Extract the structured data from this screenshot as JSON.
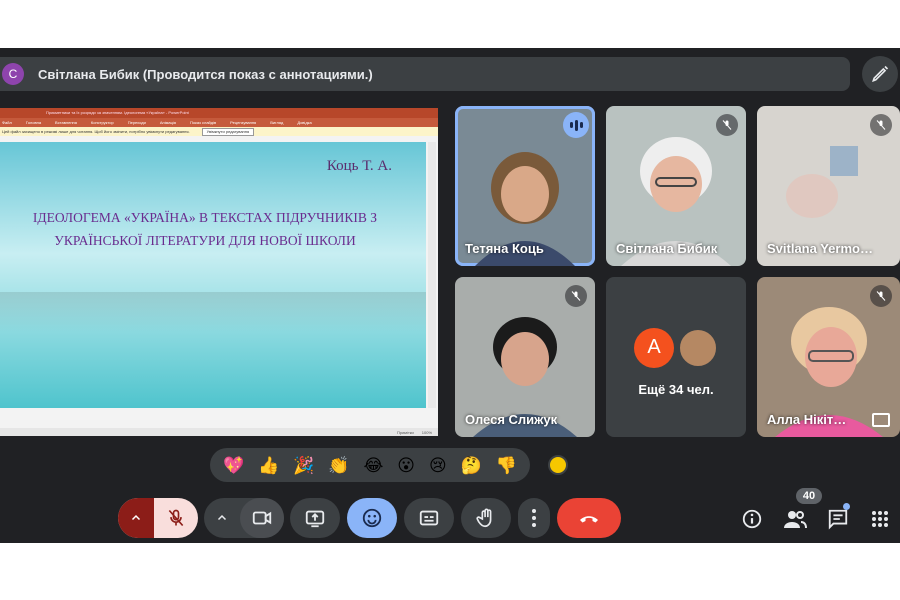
{
  "banner": {
    "avatar_letter": "С",
    "text": "Світлана Бибик (Проводится показ с аннотациями.)"
  },
  "presentation": {
    "window_title": "Прикметники та їх розряди за значенням. Ідеологема «Україна» - PowerPoint",
    "ribbon": [
      "Файл",
      "Головна",
      "Вставлення",
      "Конструктор",
      "Переходи",
      "Анімація",
      "Показ слайдів",
      "Рецензування",
      "Вигляд",
      "Довідка"
    ],
    "warning_text": "Цей файл захищено в режимі лише для читання. Щоб його змінити, потрібно увімкнути редагування.",
    "warning_button": "Увімкнути редагування",
    "author": "Коць Т. А.",
    "heading_line1": "ІДЕОЛОГЕМА «УКРАЇНА» В ТЕКСТАХ ПІДРУЧНИКІВ З",
    "heading_line2": "УКРАЇНСЬКОЇ ЛІТЕРАТУРИ ДЛЯ НОВОЇ ШКОЛИ",
    "status": [
      "Примітки",
      "100%"
    ]
  },
  "participants": [
    {
      "name": "Тетяна Коць",
      "state": "speaking"
    },
    {
      "name": "Світлана Бибик",
      "state": "muted"
    },
    {
      "name": "Svitlana Yermo…",
      "state": "muted"
    },
    {
      "name": "Олеся Слижук",
      "state": "muted"
    },
    {
      "name": "Алла Нікіт…",
      "state": "muted"
    }
  ],
  "more_tile": {
    "avatar_letter": "А",
    "label": "Ещё 34 чел."
  },
  "reactions": [
    "💖",
    "👍",
    "🎉",
    "👏",
    "😂",
    "😮",
    "😢",
    "🤔",
    "👎"
  ],
  "people_count": "40",
  "colors": {
    "end_call": "#ea4335",
    "active_accent": "#8ab4f8",
    "mic_off_bg": "#f9dedc"
  }
}
